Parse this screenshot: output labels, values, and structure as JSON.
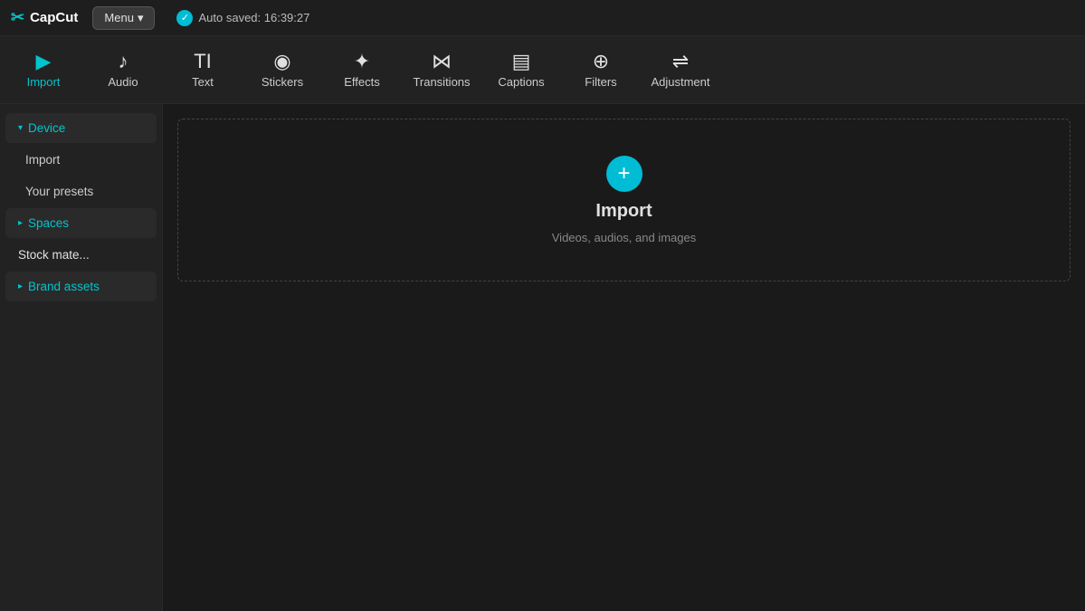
{
  "topbar": {
    "logo_icon": "✂",
    "logo_text": "CapCut",
    "menu_label": "Menu",
    "menu_arrow": "▾",
    "autosave_text": "Auto saved: 16:39:27"
  },
  "navbar": {
    "items": [
      {
        "id": "import",
        "icon": "▶",
        "label": "Import",
        "active": true
      },
      {
        "id": "audio",
        "icon": "♪",
        "label": "Audio",
        "active": false
      },
      {
        "id": "text",
        "icon": "TI",
        "label": "Text",
        "active": false
      },
      {
        "id": "stickers",
        "icon": "◎",
        "label": "Stickers",
        "active": false
      },
      {
        "id": "effects",
        "icon": "✦",
        "label": "Effects",
        "active": false
      },
      {
        "id": "transitions",
        "icon": "⊳⊲",
        "label": "Transitions",
        "active": false
      },
      {
        "id": "captions",
        "icon": "▤",
        "label": "Captions",
        "active": false
      },
      {
        "id": "filters",
        "icon": "⊕",
        "label": "Filters",
        "active": false
      },
      {
        "id": "adjustment",
        "icon": "⇌",
        "label": "Adjustment",
        "active": false
      }
    ]
  },
  "sidebar": {
    "items": [
      {
        "id": "device",
        "label": "Device",
        "type": "section",
        "expanded": true,
        "arrow": "▾"
      },
      {
        "id": "import-sub",
        "label": "Import",
        "type": "sub"
      },
      {
        "id": "your-presets",
        "label": "Your presets",
        "type": "sub"
      },
      {
        "id": "spaces",
        "label": "Spaces",
        "type": "section",
        "expanded": false,
        "arrow": "▸"
      },
      {
        "id": "stock-materials",
        "label": "Stock mate...",
        "type": "item"
      },
      {
        "id": "brand-assets",
        "label": "Brand assets",
        "type": "section",
        "expanded": false,
        "arrow": "▸"
      }
    ]
  },
  "import_zone": {
    "plus_icon": "+",
    "title": "Import",
    "subtitle": "Videos, audios, and images"
  }
}
